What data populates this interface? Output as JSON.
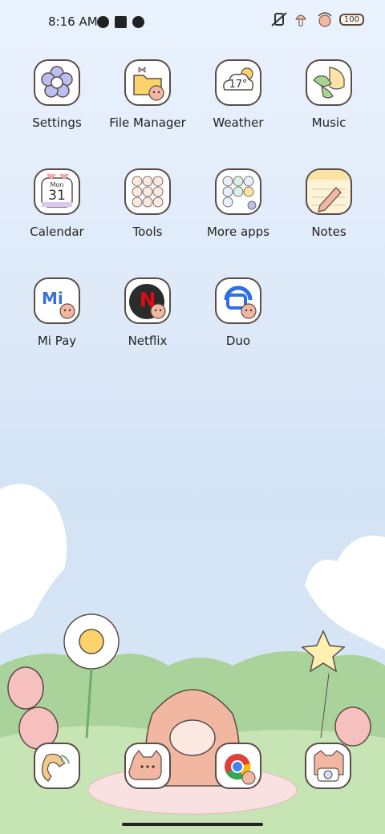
{
  "status_bar": {
    "time": "8:16 AM",
    "battery": "100"
  },
  "apps": [
    {
      "label": "Settings",
      "icon": "settings-flower-icon"
    },
    {
      "label": "File Manager",
      "icon": "folder-icon"
    },
    {
      "label": "Weather",
      "icon": "weather-cloud-icon",
      "temp": "17°"
    },
    {
      "label": "Music",
      "icon": "music-note-icon"
    },
    {
      "label": "Calendar",
      "icon": "calendar-icon",
      "month": "Mon",
      "day": "31"
    },
    {
      "label": "Tools",
      "icon": "tools-folder-icon"
    },
    {
      "label": "More apps",
      "icon": "more-apps-folder-icon"
    },
    {
      "label": "Notes",
      "icon": "notes-pencil-icon"
    },
    {
      "label": "Mi Pay",
      "icon": "mi-pay-icon",
      "mark": "Mi"
    },
    {
      "label": "Netflix",
      "icon": "netflix-icon",
      "mark": "N"
    },
    {
      "label": "Duo",
      "icon": "duo-icon"
    }
  ],
  "dock": [
    {
      "icon": "phone-icon"
    },
    {
      "icon": "messages-cat-icon"
    },
    {
      "icon": "chrome-icon"
    },
    {
      "icon": "camera-icon"
    }
  ],
  "colors": {
    "sky_top": "#eaf2fd",
    "tile_border": "#5a4d48",
    "accent_peach": "#f2b7a0"
  }
}
